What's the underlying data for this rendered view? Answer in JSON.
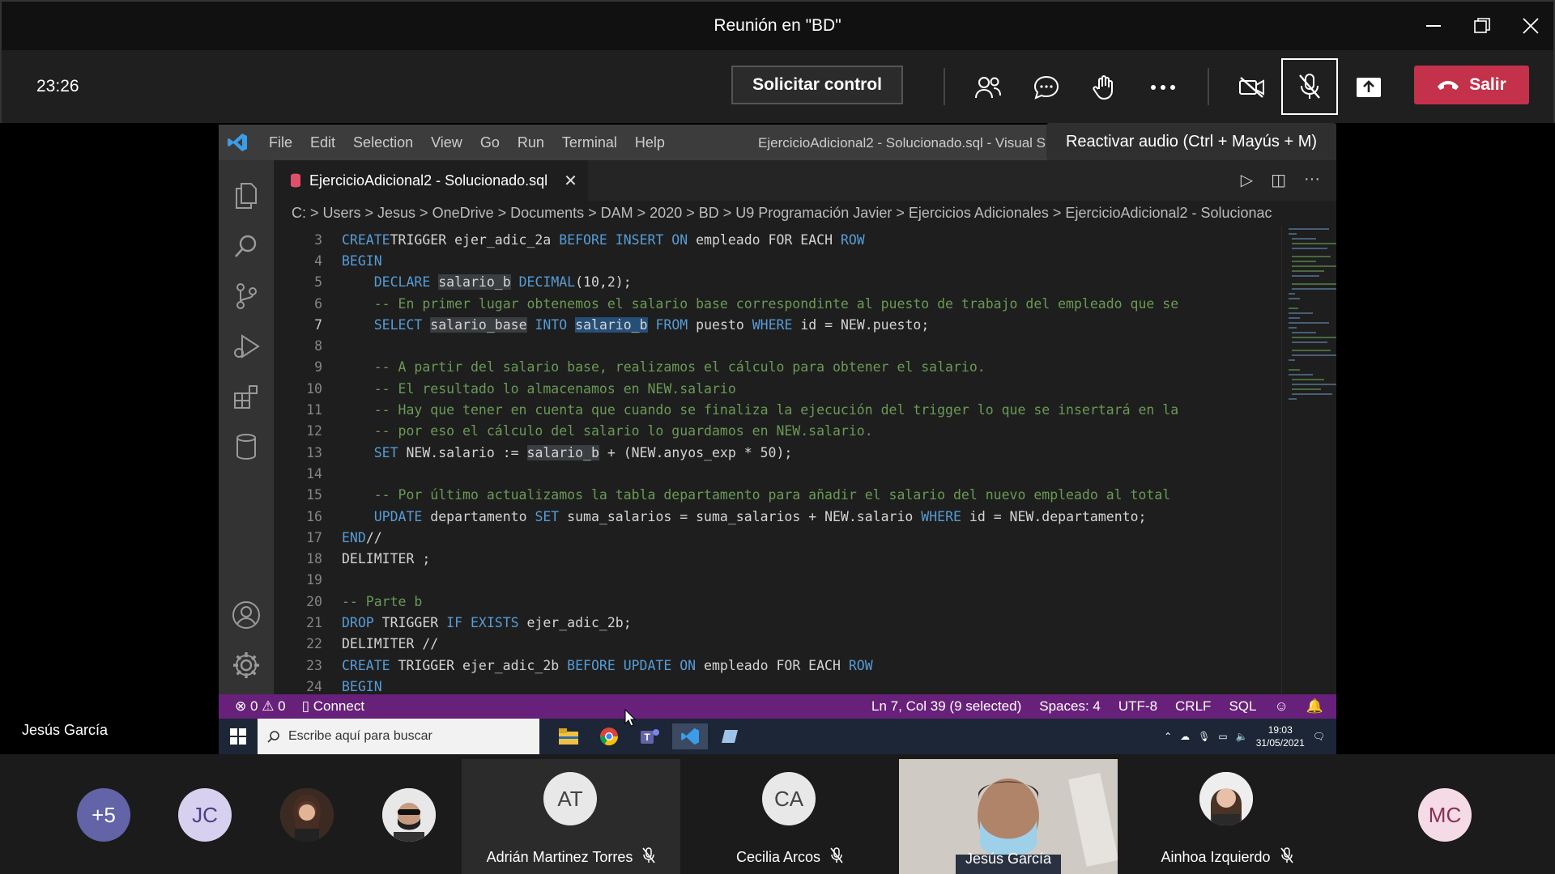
{
  "window": {
    "title": "Reunión en \"BD\""
  },
  "toolbar": {
    "timer": "23:26",
    "request_control_label": "Solicitar control",
    "leave_label": "Salir",
    "tooltip": "Reactivar audio (Ctrl + Mayús + M)"
  },
  "presenter": {
    "name": "Jesús García"
  },
  "vscode": {
    "menu": [
      "File",
      "Edit",
      "Selection",
      "View",
      "Go",
      "Run",
      "Terminal",
      "Help"
    ],
    "window_title": "EjercicioAdicional2 - Solucionado.sql - Visual S",
    "tab_filename": "EjercicioAdicional2 - Solucionado.sql",
    "breadcrumb": "C: > Users > Jesus > OneDrive > Documents > DAM > 2020 > BD > U9 Programación Javier > Ejercicios Adicionales > EjercicioAdicional2 - Solucionac",
    "lines": [
      {
        "n": "3",
        "tokens": [
          [
            "kw",
            "CREATE"
          ],
          [
            "",
            "TRIGGER ejer_adic_2a "
          ],
          [
            "kw",
            "BEFORE INSERT ON"
          ],
          [
            "",
            " empleado FOR EACH "
          ],
          [
            "kw",
            "ROW"
          ]
        ]
      },
      {
        "n": "4",
        "tokens": [
          [
            "kw",
            "BEGIN"
          ]
        ]
      },
      {
        "n": "5",
        "tokens": [
          [
            "",
            "    "
          ],
          [
            "kw",
            "DECLARE"
          ],
          [
            "",
            " "
          ],
          [
            "hl",
            "salario_b"
          ],
          [
            "",
            " "
          ],
          [
            "kw",
            "DECIMAL"
          ],
          [
            "",
            "(10,2);"
          ]
        ]
      },
      {
        "n": "6",
        "tokens": [
          [
            "",
            "    "
          ],
          [
            "cm",
            "-- En primer lugar obtenemos el salario base correspondinte al puesto de trabajo del empleado que se"
          ]
        ]
      },
      {
        "n": "7",
        "tokens": [
          [
            "",
            "    "
          ],
          [
            "kw",
            "SELECT"
          ],
          [
            "",
            " "
          ],
          [
            "hl",
            "salario_base"
          ],
          [
            "",
            " "
          ],
          [
            "kw",
            "INTO"
          ],
          [
            "",
            " "
          ],
          [
            "sel",
            "salario_b"
          ],
          [
            "",
            " "
          ],
          [
            "kw",
            "FROM"
          ],
          [
            "",
            " puesto "
          ],
          [
            "kw",
            "WHERE"
          ],
          [
            "",
            " id = NEW.puesto;"
          ]
        ]
      },
      {
        "n": "8",
        "tokens": []
      },
      {
        "n": "9",
        "tokens": [
          [
            "",
            "    "
          ],
          [
            "cm",
            "-- A partir del salario base, realizamos el cálculo para obtener el salario."
          ]
        ]
      },
      {
        "n": "10",
        "tokens": [
          [
            "",
            "    "
          ],
          [
            "cm",
            "-- El resultado lo almacenamos en NEW.salario"
          ]
        ]
      },
      {
        "n": "11",
        "tokens": [
          [
            "",
            "    "
          ],
          [
            "cm",
            "-- Hay que tener en cuenta que cuando se finaliza la ejecución del trigger lo que se insertará en la"
          ]
        ]
      },
      {
        "n": "12",
        "tokens": [
          [
            "",
            "    "
          ],
          [
            "cm",
            "-- por eso el cálculo del salario lo guardamos en NEW.salario."
          ]
        ]
      },
      {
        "n": "13",
        "tokens": [
          [
            "",
            "    "
          ],
          [
            "kw",
            "SET"
          ],
          [
            "",
            " NEW.salario := "
          ],
          [
            "hl",
            "salario_b"
          ],
          [
            "",
            " + (NEW.anyos_exp * 50);"
          ]
        ]
      },
      {
        "n": "14",
        "tokens": []
      },
      {
        "n": "15",
        "tokens": [
          [
            "",
            "    "
          ],
          [
            "cm",
            "-- Por último actualizamos la tabla departamento para añadir el salario del nuevo empleado al total"
          ]
        ]
      },
      {
        "n": "16",
        "tokens": [
          [
            "",
            "    "
          ],
          [
            "kw",
            "UPDATE"
          ],
          [
            "",
            " departamento "
          ],
          [
            "kw",
            "SET"
          ],
          [
            "",
            " suma_salarios = suma_salarios + NEW.salario "
          ],
          [
            "kw",
            "WHERE"
          ],
          [
            "",
            " id = NEW.departamento;"
          ]
        ]
      },
      {
        "n": "17",
        "tokens": [
          [
            "kw",
            "END"
          ],
          [
            "",
            "//"
          ]
        ]
      },
      {
        "n": "18",
        "tokens": [
          [
            "",
            "DELIMITER ;"
          ]
        ]
      },
      {
        "n": "19",
        "tokens": []
      },
      {
        "n": "20",
        "tokens": [
          [
            "cm",
            "-- Parte b"
          ]
        ]
      },
      {
        "n": "21",
        "tokens": [
          [
            "kw",
            "DROP"
          ],
          [
            "",
            " TRIGGER "
          ],
          [
            "kw",
            "IF EXISTS"
          ],
          [
            "",
            " ejer_adic_2b;"
          ]
        ]
      },
      {
        "n": "22",
        "tokens": [
          [
            "",
            "DELIMITER //"
          ]
        ]
      },
      {
        "n": "23",
        "tokens": [
          [
            "kw",
            "CREATE"
          ],
          [
            "",
            " TRIGGER ejer_adic_2b "
          ],
          [
            "kw",
            "BEFORE UPDATE ON"
          ],
          [
            "",
            " empleado FOR EACH "
          ],
          [
            "kw",
            "ROW"
          ]
        ]
      },
      {
        "n": "24",
        "tokens": [
          [
            "kw",
            "BEGIN"
          ]
        ]
      }
    ],
    "current_line": "7",
    "status_left": {
      "errors": "0",
      "warnings": "0",
      "connect": "Connect"
    },
    "status_right": [
      "Ln 7, Col 39 (9 selected)",
      "Spaces: 4",
      "UTF-8",
      "CRLF",
      "SQL"
    ]
  },
  "taskbar": {
    "search_placeholder": "Escribe aquí para buscar",
    "time": "19:03",
    "date": "31/05/2021"
  },
  "gallery": {
    "overflow": "+5",
    "initial_avatars": [
      {
        "initials": "JC",
        "bg": "#d8d0ef",
        "fg": "#4b3f8a"
      },
      {
        "initials": "MC",
        "bg": "#f4dbe6",
        "fg": "#8a2f56"
      }
    ],
    "named_tiles": [
      {
        "name": "Adrián Martinez Torres",
        "initials": "AT"
      },
      {
        "name": "Cecilia Arcos",
        "initials": "CA"
      },
      {
        "name": "Jesús García"
      },
      {
        "name": "Ainhoa Izquierdo"
      }
    ]
  },
  "colors": {
    "accent_leave": "#c4314b",
    "status_bar": "#68217a",
    "overflow_avatar": "#6264a7"
  }
}
